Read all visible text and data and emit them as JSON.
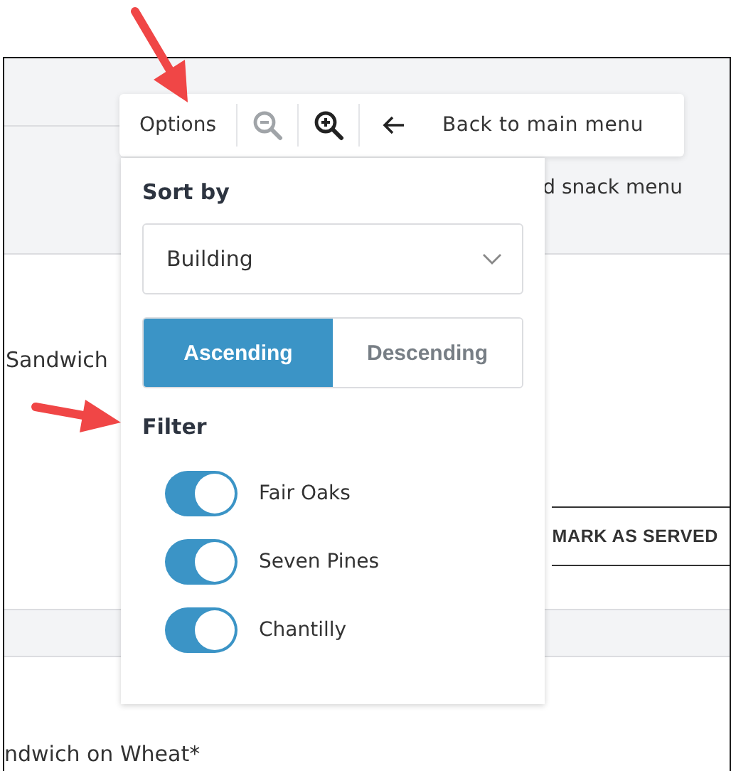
{
  "background": {
    "header_text": "d snack menu",
    "row_text": "Sandwich",
    "action": "MARK AS SERVED",
    "next_row_text": "ndwich on Wheat*"
  },
  "toolbar": {
    "options": "Options",
    "zoom_out": {
      "disabled": true
    },
    "zoom_in": {
      "disabled": false
    },
    "back": "Back to main menu"
  },
  "options_panel": {
    "sort_label": "Sort by",
    "sort_field": {
      "value": "Building"
    },
    "order": [
      {
        "label": "Ascending",
        "selected": true
      },
      {
        "label": "Descending",
        "selected": false
      }
    ],
    "filter_label": "Filter",
    "filters": [
      {
        "label": "Fair Oaks",
        "on": true
      },
      {
        "label": "Seven Pines",
        "on": true
      },
      {
        "label": "Chantilly",
        "on": true
      }
    ]
  }
}
